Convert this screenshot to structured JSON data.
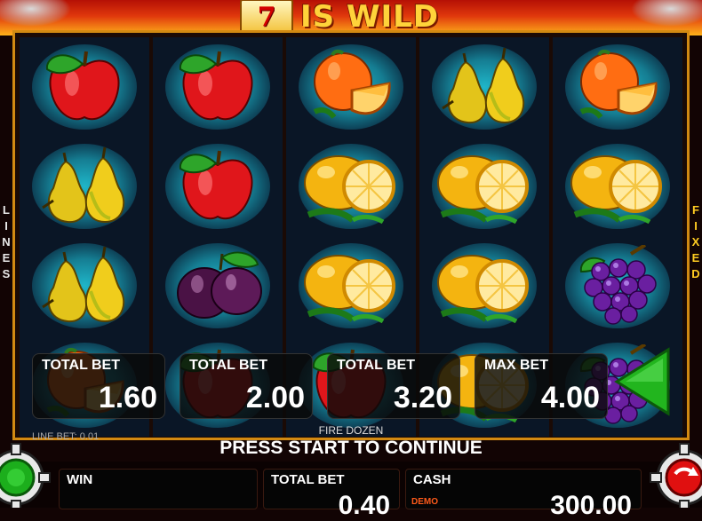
{
  "header": {
    "seven_symbol": "7",
    "title": "IS WILD"
  },
  "side_labels": {
    "left": [
      "L",
      "I",
      "N",
      "E",
      "S"
    ],
    "right": [
      "F",
      "I",
      "X",
      "E",
      "D"
    ]
  },
  "reels": [
    [
      "apple",
      "pear",
      "pear",
      "orange"
    ],
    [
      "apple",
      "apple",
      "plum",
      "apple"
    ],
    [
      "orange",
      "lemon",
      "lemon",
      "apple"
    ],
    [
      "pear",
      "lemon",
      "lemon",
      "lemon"
    ],
    [
      "orange",
      "lemon",
      "grapes",
      "grapes"
    ]
  ],
  "bets": [
    {
      "label": "TOTAL BET",
      "value": "1.60"
    },
    {
      "label": "TOTAL BET",
      "value": "2.00"
    },
    {
      "label": "TOTAL BET",
      "value": "3.20"
    },
    {
      "label": "MAX BET",
      "value": "4.00"
    }
  ],
  "line_bet": "LINE BET: 0.01",
  "game_name": "FIRE DOZEN",
  "status_message": "PRESS START TO CONTINUE",
  "panels": {
    "win": {
      "label": "WIN",
      "value": ""
    },
    "total_bet": {
      "label": "TOTAL BET",
      "value": "0.40"
    },
    "cash": {
      "label": "CASH",
      "value": "300.00",
      "mode": "DEMO"
    }
  },
  "colors": {
    "frame_gold": "#d28a12",
    "play_green": "#22b51e",
    "accent_red": "#e01010"
  },
  "icons": {
    "play": "play-arrow-icon",
    "left_gear": "gear-icon",
    "right_gear": "gear-icon"
  }
}
